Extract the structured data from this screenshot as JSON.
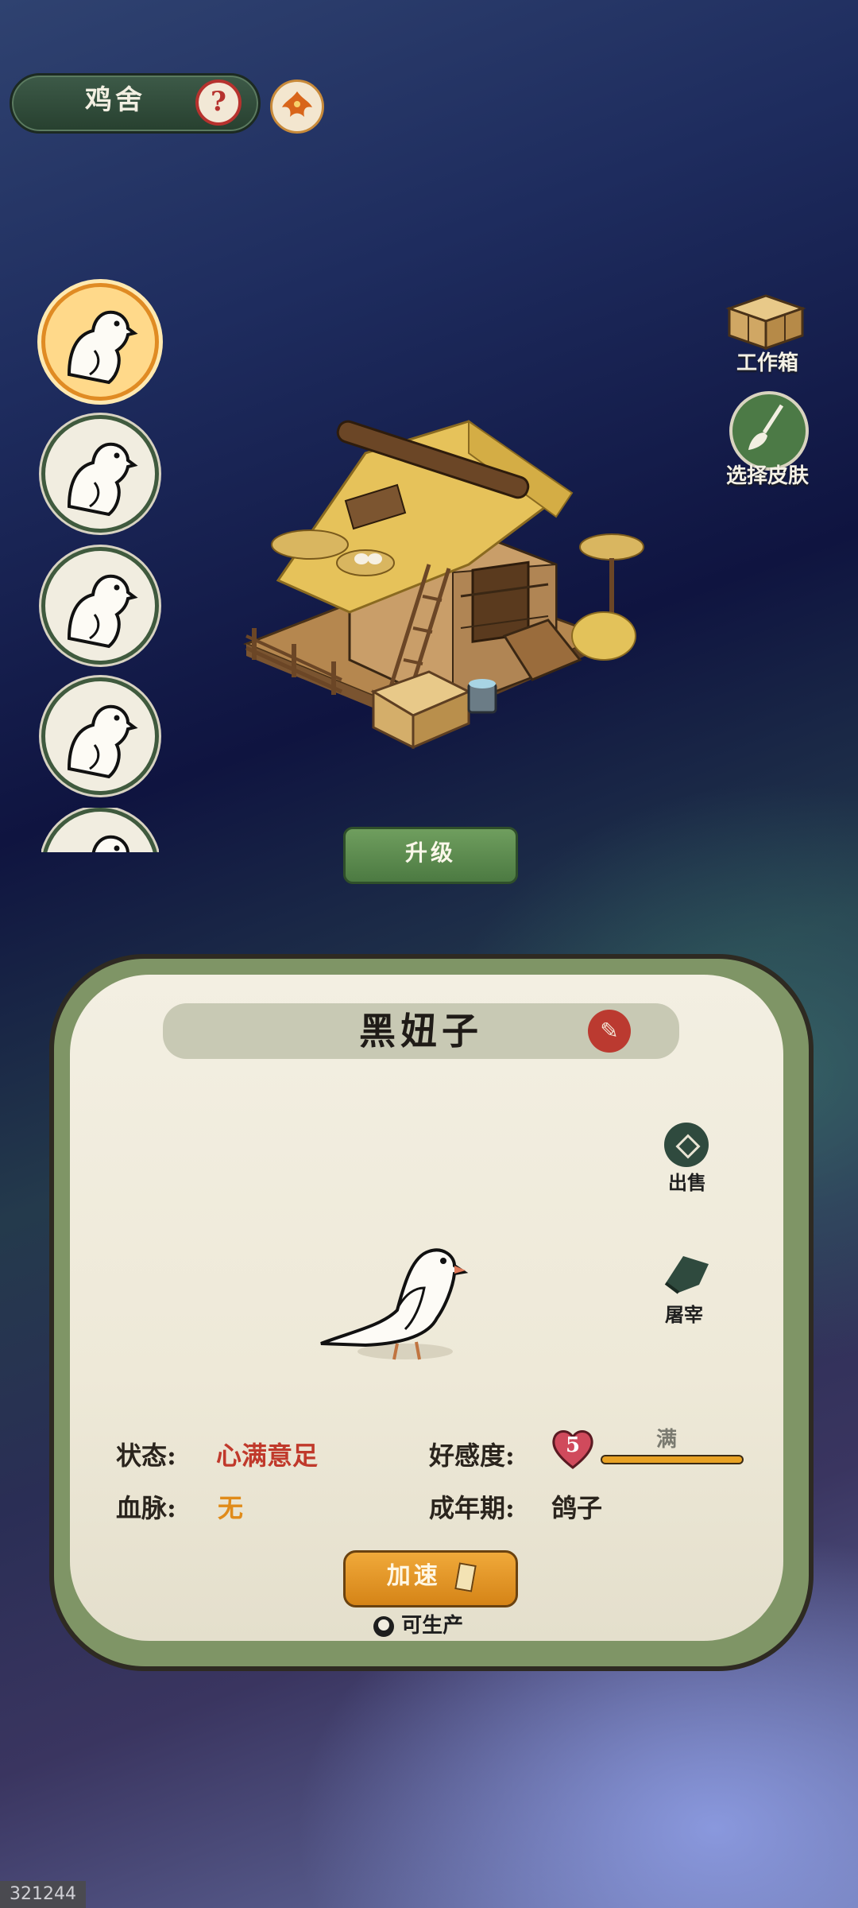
{
  "header": {
    "title": "鸡舍",
    "help_icon": "question-icon",
    "phoenix_icon": "phoenix-icon"
  },
  "bird_list": {
    "items": [
      {
        "icon": "dove-icon",
        "selected": true
      },
      {
        "icon": "dove-icon",
        "selected": false
      },
      {
        "icon": "dove-icon",
        "selected": false
      },
      {
        "icon": "dove-icon",
        "selected": false
      },
      {
        "icon": "dove-icon",
        "selected": false
      }
    ]
  },
  "right_actions": {
    "workbox_label": "工作箱",
    "skin_label": "选择皮肤"
  },
  "upgrade_label": "升级",
  "panel": {
    "name": "黑妞子",
    "sell_label": "出售",
    "slaughter_label": "屠宰",
    "status_label": "状态:",
    "status_value": "心满意足",
    "affection_label": "好感度:",
    "affection_level": "5",
    "affection_full": "满",
    "affection_progress": 1.0,
    "bloodline_label": "血脉:",
    "bloodline_value": "无",
    "adult_label": "成年期:",
    "adult_value": "鸽子",
    "speed_label": "加速",
    "produce_label": "可生产"
  },
  "colors": {
    "status_red": "#c0392b",
    "bloodline_orange": "#e08b1a",
    "accent_green": "#5f8f52",
    "accent_orange": "#e3961f"
  },
  "corner_id": "321244"
}
